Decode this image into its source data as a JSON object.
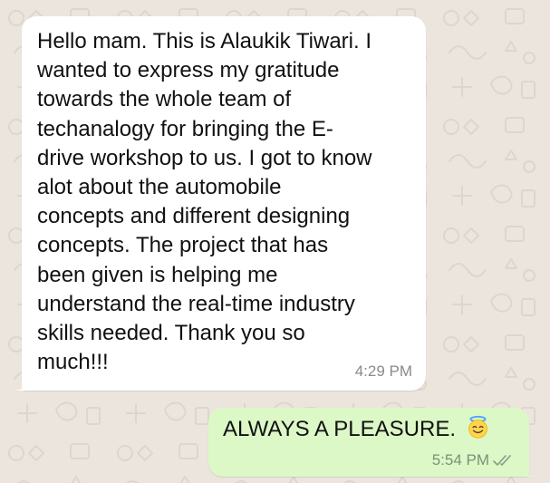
{
  "chat": {
    "incoming": {
      "text": "Hello mam. This is Alaukik  Tiwari. I\nwanted to express my gratitude\ntowards the whole team of\ntechanalogy for bringing the E-\ndrive workshop to us. I got to know\nalot about the automobile\nconcepts and different designing\nconcepts. The project that has\nbeen given is helping me\nunderstand the real-time industry\nskills needed. Thank you so\nmuch!!!",
      "time": "4:29 PM"
    },
    "outgoing": {
      "text": "ALWAYS A PLEASURE.",
      "emoji_icon": "smiling-face-with-halo-icon",
      "time": "5:54 PM",
      "status_icon": "double-check-icon"
    }
  },
  "colors": {
    "wallpaper": "#ece5dd",
    "incoming_bubble": "#ffffff",
    "outgoing_bubble": "#dcf8c6",
    "timestamp": "#8a8a8a"
  }
}
